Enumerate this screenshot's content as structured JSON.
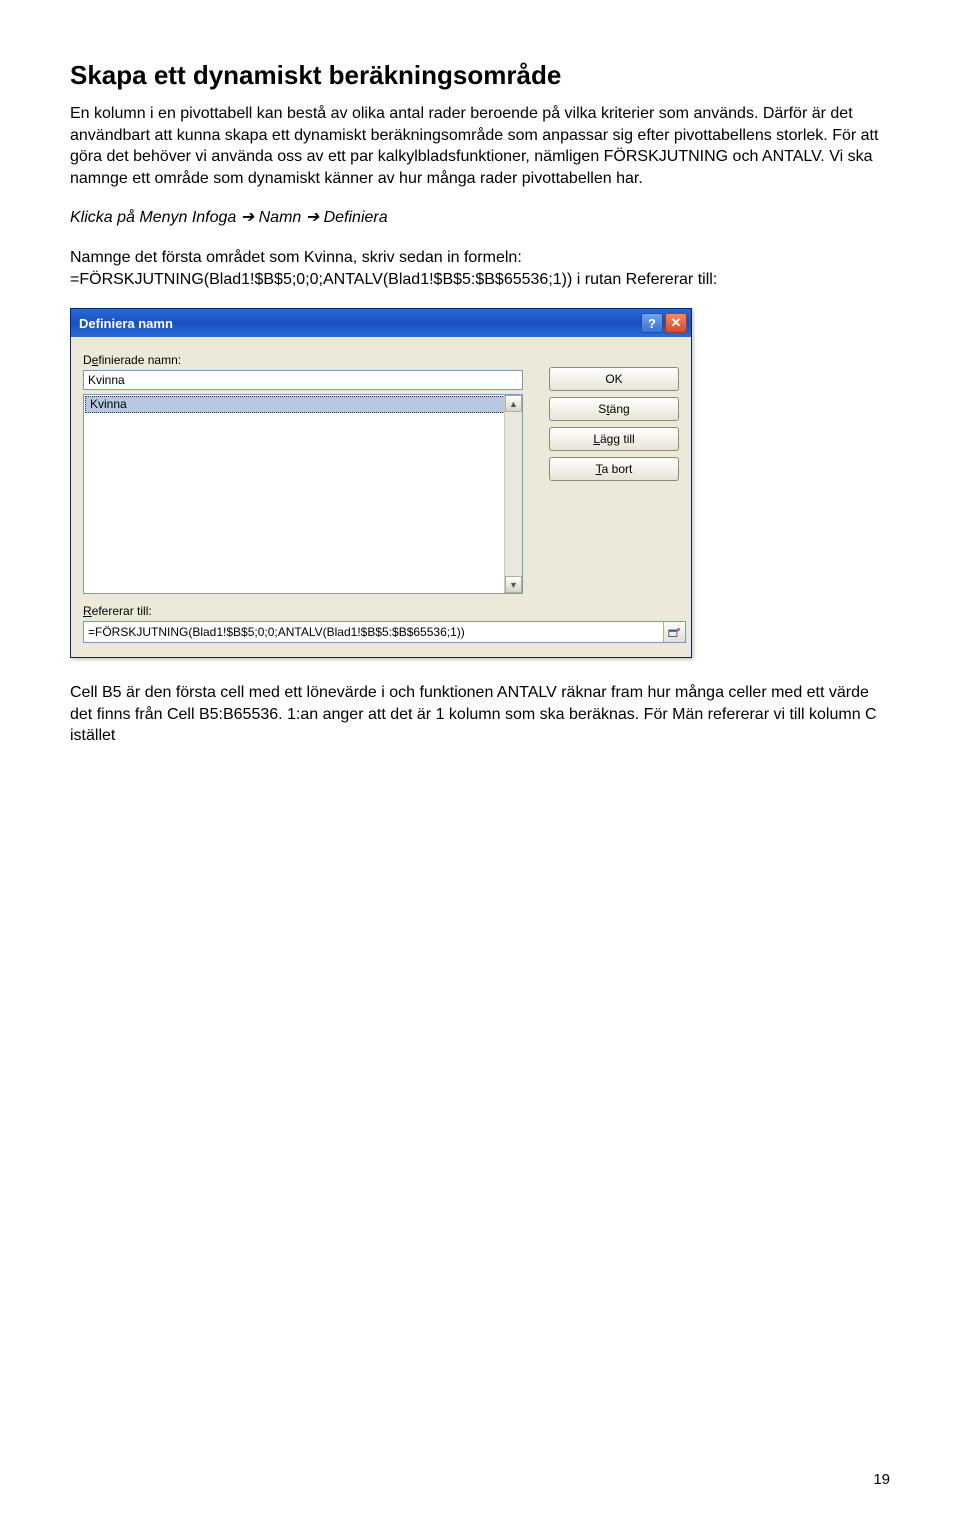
{
  "heading": "Skapa ett dynamiskt beräkningsområde",
  "para1": "En kolumn i en pivottabell kan bestå av olika antal rader beroende på vilka kriterier som används. Därför är det användbart att kunna skapa ett dynamiskt beräkningsområde som anpassar sig efter pivottabellens storlek. För att göra det behöver vi använda oss av ett par kalkylbladsfunktioner, nämligen FÖRSKJUTNING och ANTALV. Vi ska namnge ett område som dynamiskt känner av hur många rader pivottabellen har.",
  "para2_pre": "Klicka på Menyn Infoga ",
  "para2_mid": " Namn ",
  "para2_post": " Definiera",
  "arrow": "➔",
  "para3a": "Namnge det första området som Kvinna, skriv sedan in formeln:",
  "para3b": "=FÖRSKJUTNING(Blad1!$B$5;0;0;ANTALV(Blad1!$B$5:$B$65536;1)) i rutan Refererar till:",
  "dialog": {
    "title": "Definiera namn",
    "label_names_pre": "D",
    "label_names_under": "e",
    "label_names_post": "finierade namn:",
    "input_value": "Kvinna",
    "list_item": "Kvinna",
    "label_ref_under": "R",
    "label_ref_post": "efererar till:",
    "ref_value": "=FÖRSKJUTNING(Blad1!$B$5;0;0;ANTALV(Blad1!$B$5:$B$65536;1))",
    "buttons": {
      "ok": "OK",
      "close_pre": "S",
      "close_under": "t",
      "close_post": "äng",
      "add_under": "L",
      "add_post": "ägg till",
      "remove_under": "T",
      "remove_post": "a bort"
    }
  },
  "para4": "Cell B5 är den första cell med ett lönevärde i och funktionen ANTALV räknar fram hur många celler med ett värde det finns från Cell B5:B65536. 1:an anger att det är 1 kolumn som ska beräknas. För Män refererar vi till kolumn C istället",
  "page_number": "19"
}
